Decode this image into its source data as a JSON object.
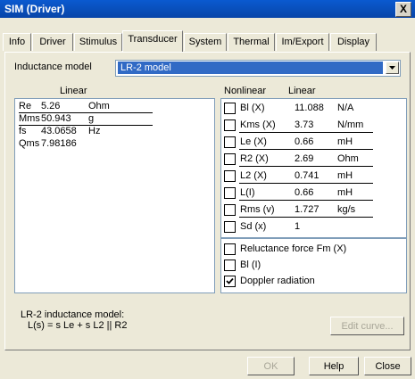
{
  "window": {
    "title": "SIM (Driver)",
    "close_glyph": "X"
  },
  "tabs": [
    {
      "label": "Info",
      "active": false
    },
    {
      "label": "Driver",
      "active": false
    },
    {
      "label": "Stimulus",
      "active": false
    },
    {
      "label": "Transducer",
      "active": true
    },
    {
      "label": "System",
      "active": false
    },
    {
      "label": "Thermal",
      "active": false
    },
    {
      "label": "Im/Export",
      "active": false
    },
    {
      "label": "Display",
      "active": false
    }
  ],
  "inductance": {
    "label": "Inductance model",
    "value": "LR-2 model"
  },
  "linear": {
    "header": "Linear",
    "rows": [
      {
        "name": "Re",
        "value": "5.26",
        "unit": "Ohm"
      },
      {
        "name": "Mms",
        "value": "50.943",
        "unit": "g"
      },
      {
        "name": "fs",
        "value": "43.0658",
        "unit": "Hz"
      },
      {
        "name": "Qms",
        "value": "7.98186",
        "unit": ""
      }
    ]
  },
  "nonlinear": {
    "header_nonlinear": "Nonlinear",
    "header_linear": "Linear",
    "rows": [
      {
        "name": "Bl (X)",
        "value": "11.088",
        "unit": "N/A",
        "checked": false
      },
      {
        "name": "Kms (X)",
        "value": "3.73",
        "unit": "N/mm",
        "checked": false
      },
      {
        "name": "Le (X)",
        "value": "0.66",
        "unit": "mH",
        "checked": false
      },
      {
        "name": "R2 (X)",
        "value": "2.69",
        "unit": "Ohm",
        "checked": false
      },
      {
        "name": "L2 (X)",
        "value": "0.741",
        "unit": "mH",
        "checked": false
      },
      {
        "name": "L(I)",
        "value": "0.66",
        "unit": "mH",
        "checked": false
      },
      {
        "name": "Rms (v)",
        "value": "1.727",
        "unit": "kg/s",
        "checked": false
      },
      {
        "name": "Sd (x)",
        "value": "1",
        "unit": "",
        "checked": false
      }
    ]
  },
  "options": [
    {
      "label": "Reluctance force Fm (X)",
      "checked": false
    },
    {
      "label": "Bl (I)",
      "checked": false
    },
    {
      "label": "Doppler radiation",
      "checked": true
    }
  ],
  "model_info": {
    "line1": "LR-2 inductance model:",
    "line2": "L(s) = s Le + s L2 || R2"
  },
  "buttons": {
    "edit_curve": "Edit curve...",
    "ok": "OK",
    "help": "Help",
    "close": "Close"
  },
  "colors": {
    "title_bar": "#0a5ad0",
    "selection": "#316ac5",
    "dialog_bg": "#ece9d8"
  }
}
